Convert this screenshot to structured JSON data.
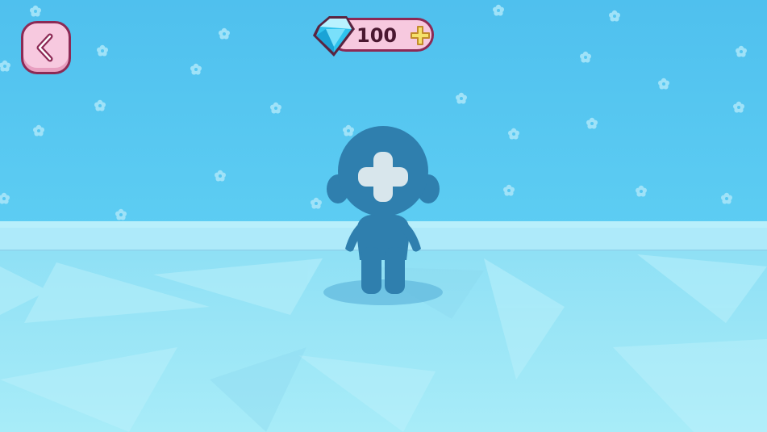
{
  "top_bar": {
    "back_icon": "chevron-left-icon",
    "currency": {
      "icon": "gem-icon",
      "amount": "100",
      "add_icon": "plus-icon"
    }
  },
  "avatar": {
    "icon": "add-avatar-silhouette",
    "overlay_icon": "plus-icon"
  },
  "colors": {
    "sky": "#55c7f1",
    "floor": "#9fe6f6",
    "silhouette": "#2f7fae",
    "button_fill": "#f7c9df",
    "button_border": "#8c2a55",
    "plus_yellow": "#f5e26b"
  }
}
